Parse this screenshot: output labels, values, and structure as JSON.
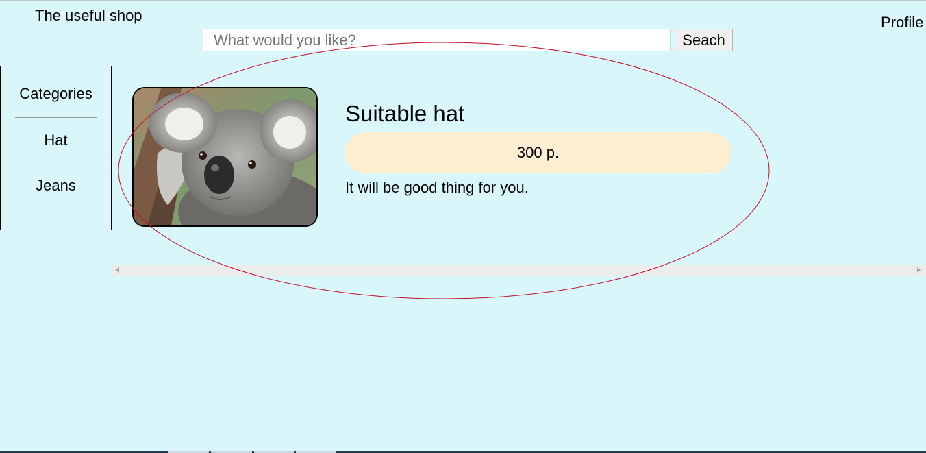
{
  "header": {
    "shop_title": "The useful shop",
    "profile_label": "Profile",
    "search": {
      "placeholder": "What would you like?",
      "value": "",
      "button_label": "Seach"
    }
  },
  "sidebar": {
    "heading": "Categories",
    "items": [
      {
        "label": "Hat"
      },
      {
        "label": "Jeans"
      }
    ]
  },
  "product": {
    "image_icon": "koala-photo",
    "name": "Suitable hat",
    "price": "300 p.",
    "description": "It will be good thing for you."
  },
  "colors": {
    "page_background": "#d9f6fa",
    "price_background": "#fdefcf",
    "annotation_stroke": "#c0102a"
  }
}
